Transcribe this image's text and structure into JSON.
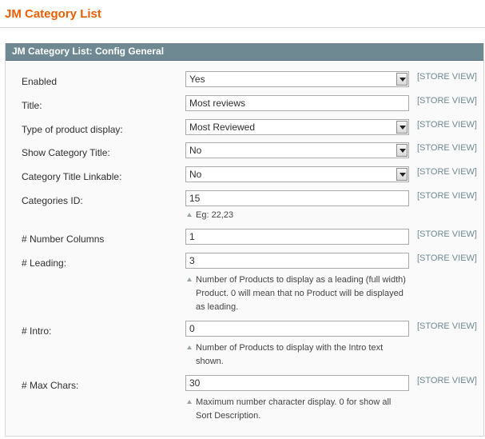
{
  "page": {
    "title": "JM Category List"
  },
  "section": {
    "title": "JM Category List: Config General"
  },
  "scope_label": "[STORE VIEW]",
  "fields": {
    "enabled": {
      "label": "Enabled",
      "value": "Yes"
    },
    "title": {
      "label": "Title:",
      "value": "Most reviews"
    },
    "product_display": {
      "label": "Type of product display:",
      "value": "Most Reviewed"
    },
    "show_category_title": {
      "label": "Show Category Title:",
      "value": "No"
    },
    "category_title_linkable": {
      "label": "Category Title Linkable:",
      "value": "No"
    },
    "categories_id": {
      "label": "Categories ID:",
      "value": "15",
      "note": "Eg: 22,23"
    },
    "number_columns": {
      "label": "# Number Columns",
      "value": "1"
    },
    "leading": {
      "label": "# Leading:",
      "value": "3",
      "note_lines": [
        "Number of Products to display as a leading (full width)",
        "Product. 0 will mean that no Product will be displayed",
        "as leading."
      ]
    },
    "intro": {
      "label": "# Intro:",
      "value": "0",
      "note_lines": [
        "Number of Products to display with the Intro text",
        "shown."
      ]
    },
    "max_chars": {
      "label": "# Max Chars:",
      "value": "30",
      "note_lines": [
        "Maximum number character display. 0 for show all",
        "Sort Description."
      ]
    }
  },
  "colors": {
    "title": "#eb5e00",
    "header_bg": "#6f8992",
    "scope_text": "#6f8992"
  }
}
